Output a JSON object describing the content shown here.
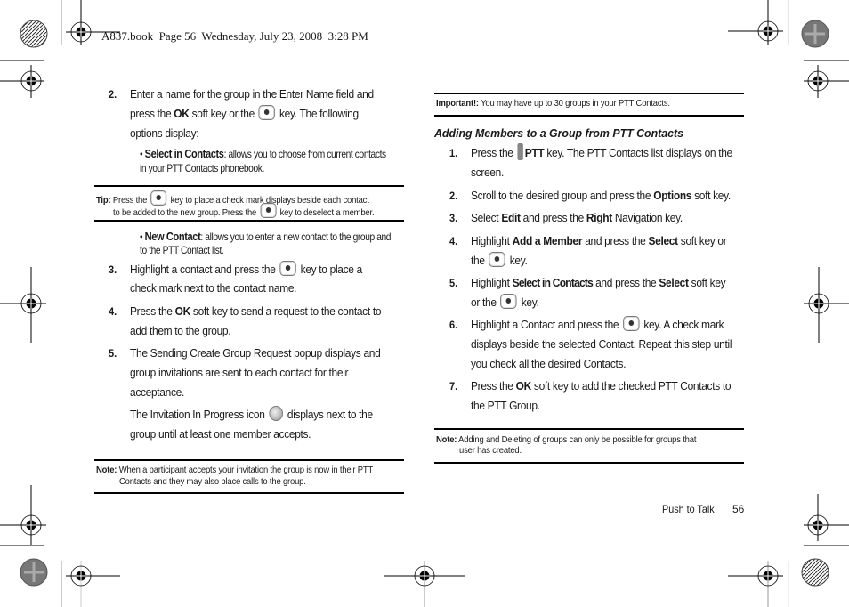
{
  "header": {
    "slug": "A837.book  Page 56  Wednesday, July 23, 2008  3:28 PM"
  },
  "left": {
    "step2": {
      "num": "2.",
      "l1": "Enter a name for the group in the Enter Name field and",
      "l2a": "press the ",
      "l2b": "OK",
      "l2c": " soft key or the ",
      "l2d": " key. The following",
      "l3": "options display:"
    },
    "bullet1": {
      "dot": "•",
      "label": "Select in Contacts",
      "l1": ": allows you to choose from current contacts",
      "l2": "in your PTT Contacts phonebook."
    },
    "tip": {
      "label": "Tip:",
      "l1a": " Press the ",
      "l1b": " key to place a check mark displays beside each contact",
      "l2a": "to be added to the new group. Press the ",
      "l2b": " key to deselect a member."
    },
    "bullet2": {
      "dot": "•",
      "label": "New Contact",
      "l1": ": allows you to enter a new contact to the group and",
      "l2": "to the PTT Contact list."
    },
    "step3": {
      "num": "3.",
      "l1a": "Highlight a contact and press the ",
      "l1b": " key to place a",
      "l2": "check mark next to the contact name."
    },
    "step4": {
      "num": "4.",
      "l1a": "Press the ",
      "l1b": "OK",
      "l1c": " soft key to send a request to the contact to",
      "l2": "add them to the group."
    },
    "step5": {
      "num": "5.",
      "l1": "The Sending Create Group Request popup displays and",
      "l2": "group invitations are sent to each contact for their",
      "l3": "acceptance.",
      "l4a": "The Invitation In Progress icon ",
      "l4b": " displays next to the",
      "l5": "group until at least one member accepts."
    },
    "note": {
      "label": "Note:",
      "l1": " When a participant accepts your invitation the group is now in their PTT",
      "l2": "Contacts and they may also place calls to the group."
    }
  },
  "right": {
    "important": {
      "label": "Important!:",
      "text": " You may have up to 30 groups in your PTT Contacts."
    },
    "heading": "Adding Members to a Group from PTT Contacts",
    "step1": {
      "num": "1.",
      "l1a": "Press the ",
      "l1b": "PTT",
      "l1c": " key. The PTT Contacts list displays on the",
      "l2": "screen."
    },
    "step2": {
      "num": "2.",
      "a": "Scroll to the desired group and press the ",
      "b": "Options",
      "c": " soft key."
    },
    "step3": {
      "num": "3.",
      "a": "Select ",
      "b": "Edit",
      "c": " and press the ",
      "d": "Right",
      "e": " Navigation key."
    },
    "step4": {
      "num": "4.",
      "a": "Highlight ",
      "b": "Add a Member",
      "c": " and press the ",
      "d": "Select",
      "e": " soft key or",
      "l2a": "the ",
      "l2b": " key."
    },
    "step5": {
      "num": "5.",
      "a": "Highlight ",
      "b": "Select in Contacts",
      "c": " and press the ",
      "d": "Select",
      "e": " soft key",
      "l2a": "or the ",
      "l2b": " key."
    },
    "step6": {
      "num": "6.",
      "l1a": "Highlight a Contact and press the ",
      "l1b": " key. A check mark",
      "l2": "displays beside the selected Contact. Repeat this step until",
      "l3": "you check all the desired Contacts."
    },
    "step7": {
      "num": "7.",
      "a": "Press the ",
      "b": "OK",
      "c": " soft key to add the checked PTT Contacts to",
      "l2": "the PTT Group."
    },
    "note": {
      "label": "Note:",
      "l1": " Adding and Deleting of groups can only be possible for groups that",
      "l2": "user has created."
    }
  },
  "footer": {
    "section": "Push to Talk",
    "page": "56"
  }
}
